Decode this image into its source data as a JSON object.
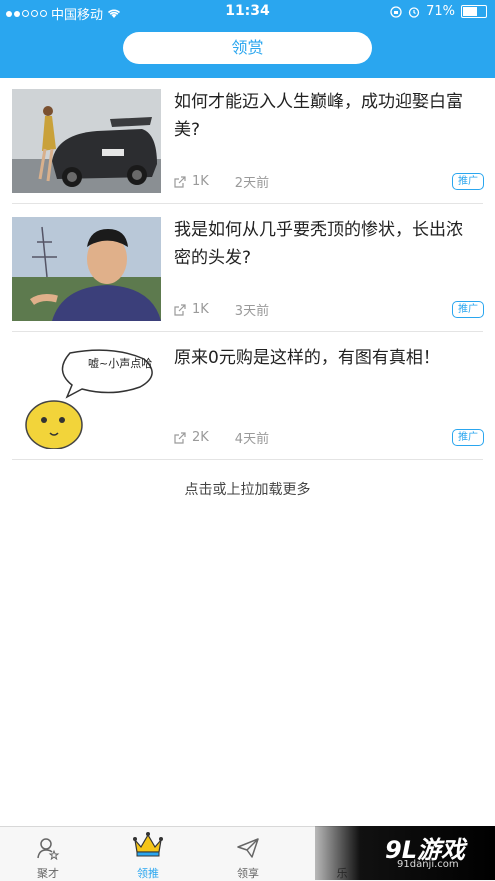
{
  "status": {
    "carrier": "中国移动",
    "time": "11:34",
    "battery": "71%",
    "battery_level": 0.71
  },
  "header": {
    "title": "领赏"
  },
  "feed": [
    {
      "title": "如何才能迈入人生巅峰，成功迎娶白富美?",
      "views": "1K",
      "time": "2天前",
      "badge": "推广"
    },
    {
      "title": "我是如何从几乎要秃顶的惨状，长出浓密的头发?",
      "views": "1K",
      "time": "3天前",
      "badge": "推广"
    },
    {
      "title": "原来0元购是这样的，有图有真相！",
      "views": "2K",
      "time": "4天前",
      "badge": "推广",
      "image_text": "嘘~小声点哈"
    }
  ],
  "load_more": "点击或上拉加载更多",
  "tabs": [
    {
      "label": "聚才",
      "icon": "person-star-icon",
      "active": false
    },
    {
      "label": "领推",
      "icon": "crown-icon",
      "active": true
    },
    {
      "label": "领享",
      "icon": "paper-plane-icon",
      "active": false
    },
    {
      "label": "乐"
    }
  ],
  "watermark": {
    "logo": "9L游戏",
    "url": "91danji.com"
  },
  "colors": {
    "accent": "#2aa6ef",
    "text": "#222222",
    "meta": "#9a9a9a"
  }
}
